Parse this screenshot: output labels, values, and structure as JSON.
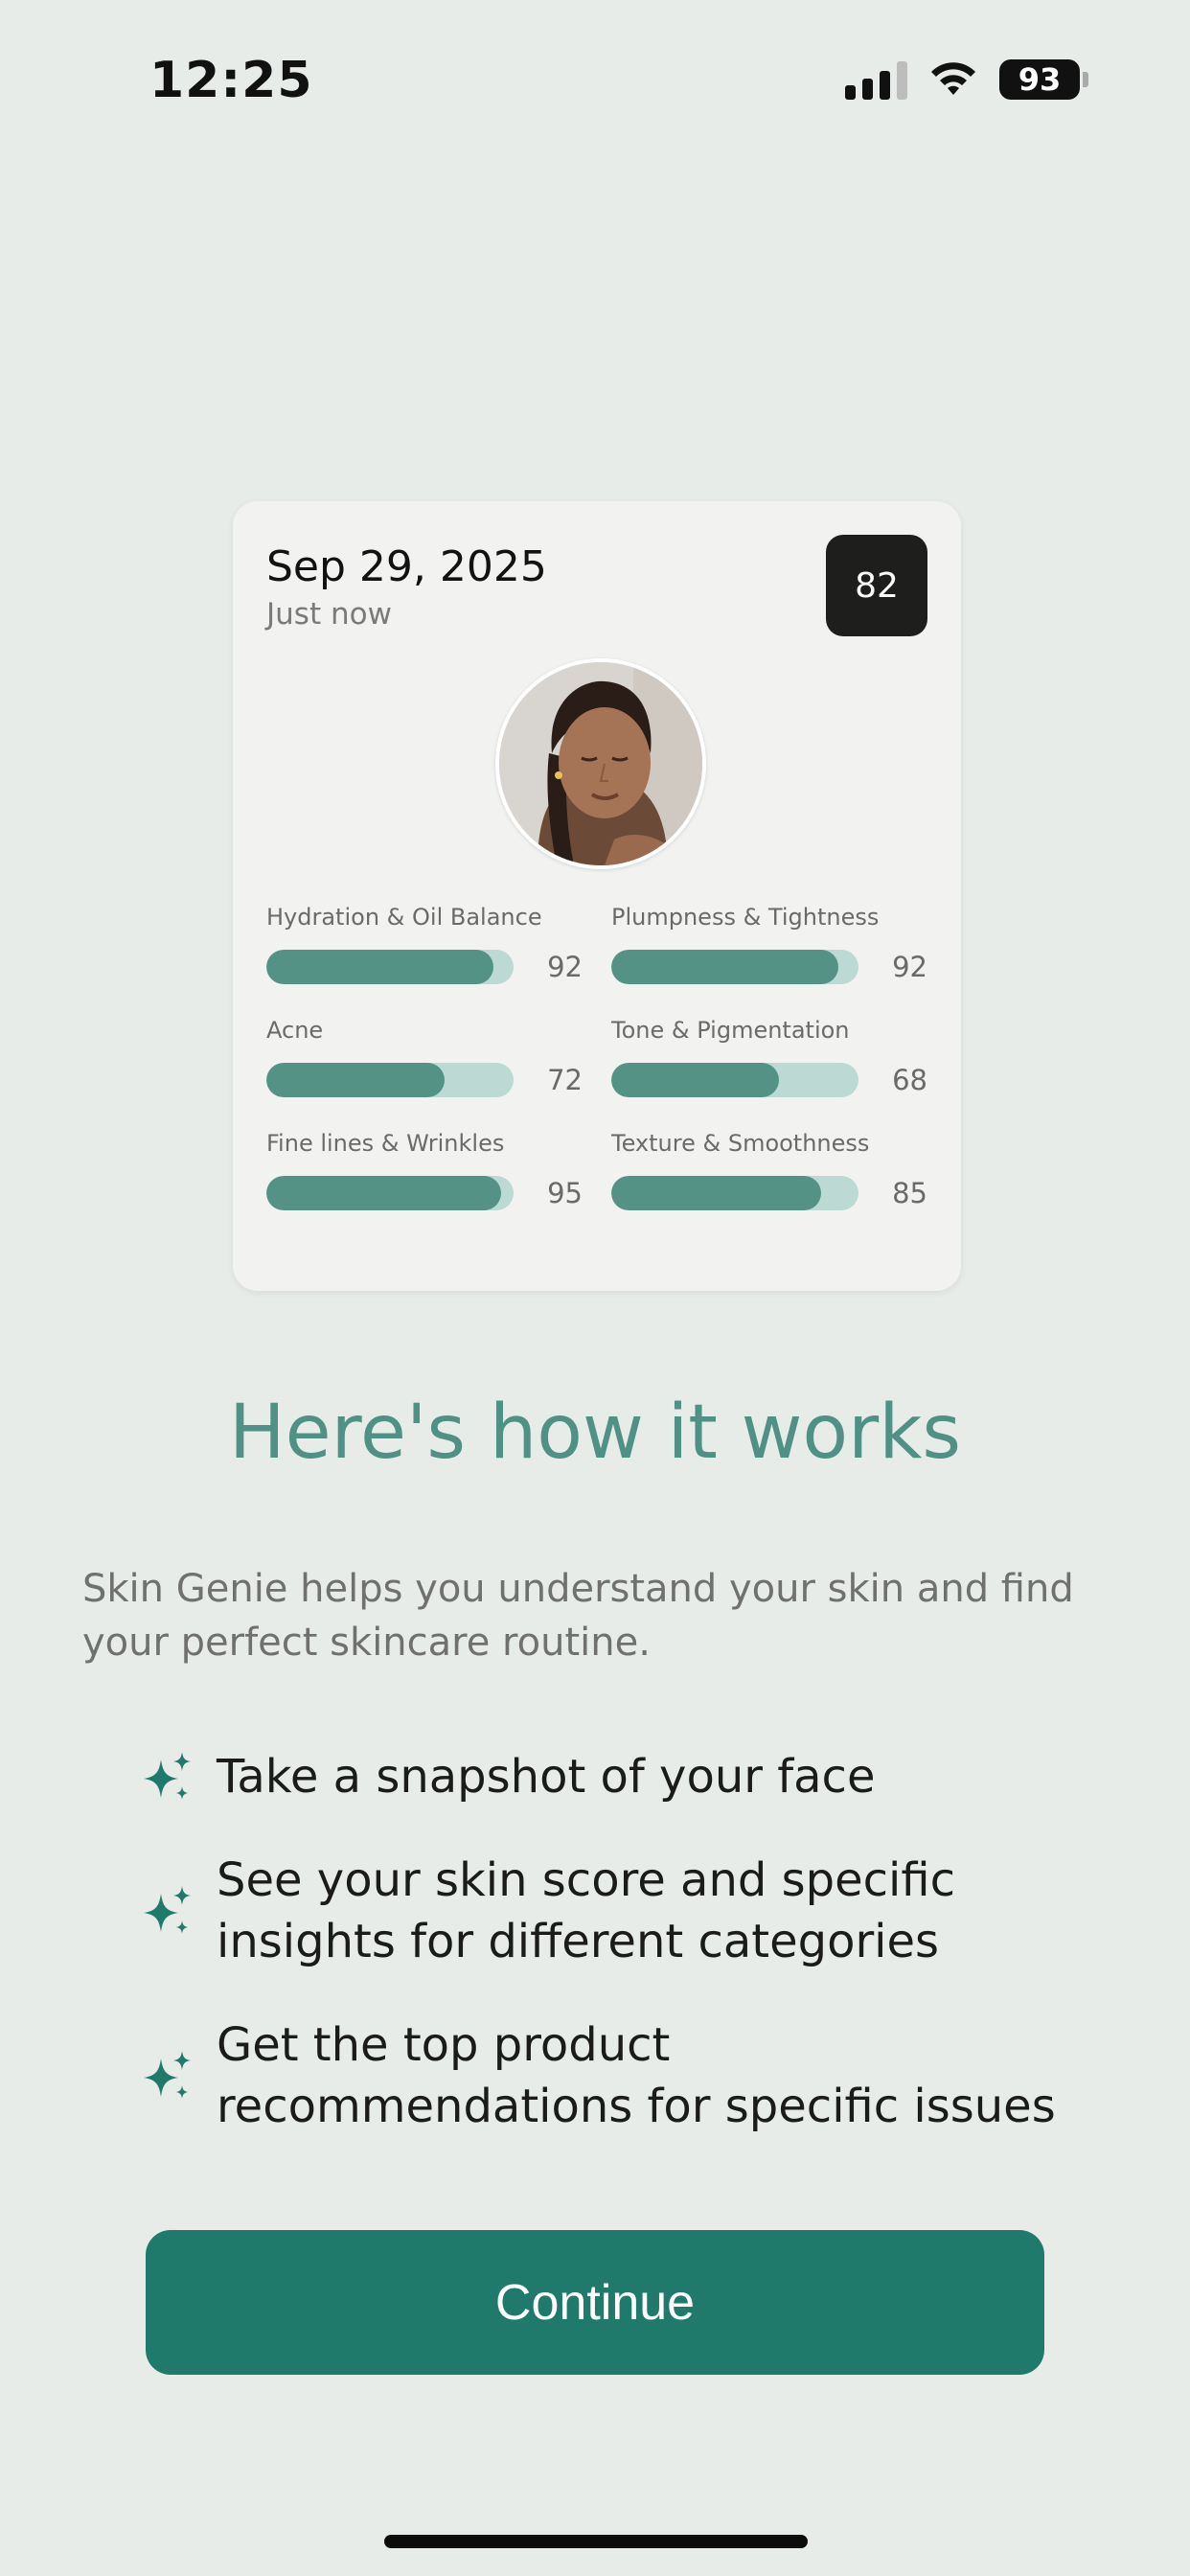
{
  "status_bar": {
    "time": "12:25",
    "battery": "93"
  },
  "card": {
    "date": "Sep 29, 2025",
    "subtitle": "Just now",
    "score": "82",
    "metrics": [
      {
        "label": "Hydration & Oil Balance",
        "value": "92"
      },
      {
        "label": "Plumpness & Tightness",
        "value": "92"
      },
      {
        "label": "Acne",
        "value": "72"
      },
      {
        "label": "Tone & Pigmentation",
        "value": "68"
      },
      {
        "label": "Fine lines & Wrinkles",
        "value": "95"
      },
      {
        "label": "Texture & Smoothness",
        "value": "85"
      }
    ]
  },
  "main": {
    "heading": "Here's how it works",
    "intro": "Skin Genie helps you understand your skin and find your perfect skincare routine.",
    "features": [
      {
        "icon": "sparkle-icon",
        "text": "Take a snapshot of your face"
      },
      {
        "icon": "sparkle-icon",
        "text": "See your skin score and specific insights for different categories"
      },
      {
        "icon": "sparkle-icon",
        "text": "Get the top product recommendations for specific issues"
      }
    ],
    "continue_label": "Continue"
  },
  "colors": {
    "background": "#e8ece8",
    "accent": "#1f7a6c",
    "heading": "#4f9185",
    "bar_fill": "#559286",
    "bar_track": "#bcdad3"
  }
}
